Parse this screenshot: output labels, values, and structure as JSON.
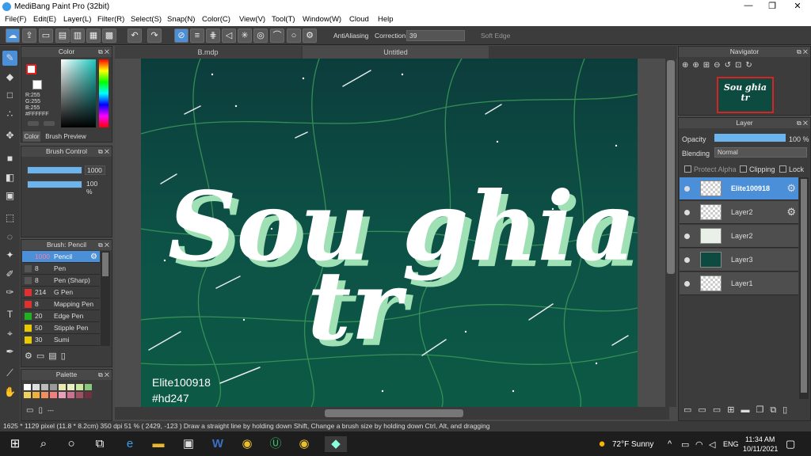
{
  "window": {
    "title": "MediBang Paint Pro (32bit)",
    "min": "—",
    "max": "❐",
    "close": "✕"
  },
  "menu": [
    "File(F)",
    "Edit(E)",
    "Layer(L)",
    "Filter(R)",
    "Select(S)",
    "Snap(N)",
    "Color(C)",
    "View(V)",
    "Tool(T)",
    "Window(W)",
    "Cloud",
    "Help"
  ],
  "toolbar": {
    "antialiasing": "AntiAliasing",
    "correction_label": "Correction",
    "correction_value": "39",
    "soft_edge": "Soft Edge"
  },
  "color_panel": {
    "title": "Color",
    "rgb": [
      "R:255",
      "G:255",
      "B:255"
    ],
    "hex": "#FFFFFF",
    "tab_color": "Color",
    "tab_preview": "Brush Preview",
    "fg": "#ffffff",
    "accent": "#e02020"
  },
  "brush_control": {
    "title": "Brush Control",
    "size": "1000",
    "opacity": "100 %"
  },
  "brush_list": {
    "title": "Brush: Pencil",
    "items": [
      {
        "size": "1000",
        "name": "Pencil",
        "color": "#4a8fd8",
        "selected": true
      },
      {
        "size": "8",
        "name": "Pen",
        "color": "#555555"
      },
      {
        "size": "8",
        "name": "Pen (Sharp)",
        "color": "#555555"
      },
      {
        "size": "214",
        "name": "G Pen",
        "color": "#e03030"
      },
      {
        "size": "8",
        "name": "Mapping Pen",
        "color": "#e03030"
      },
      {
        "size": "20",
        "name": "Edge Pen",
        "color": "#20b020"
      },
      {
        "size": "50",
        "name": "Stipple Pen",
        "color": "#e8c800"
      },
      {
        "size": "30",
        "name": "Sumi",
        "color": "#e8c800"
      }
    ]
  },
  "palette": {
    "title": "Palette",
    "footer": "---"
  },
  "tabs": [
    "B.mdp",
    "Untitled"
  ],
  "canvas": {
    "line1": "Sou ghia",
    "line2": "tr",
    "sig1": "Elite100918",
    "sig2": "#hd247"
  },
  "status": {
    "text": "1625 * 1129 pixel   (11.8 * 8.2cm)   350 dpi   51 %   ( 2429, -123 )   Draw a straight line by holding down Shift, Change a brush size by holding down Ctrl, Alt, and dragging"
  },
  "navigator": {
    "title": "Navigator"
  },
  "layers": {
    "title": "Layer",
    "opacity_label": "Opacity",
    "opacity_value": "100 %",
    "blending_label": "Blending",
    "blending_value": "Normal",
    "protect_alpha": "Protect Alpha",
    "clipping": "Clipping",
    "lock": "Lock",
    "items": [
      {
        "name": "Elite100918",
        "selected": true
      },
      {
        "name": "Layer2"
      },
      {
        "name": "Layer2"
      },
      {
        "name": "Layer3"
      },
      {
        "name": "Layer1"
      }
    ]
  },
  "taskbar": {
    "weather": "72°F  Sunny",
    "lang": "ENG",
    "time": "11:34 AM",
    "date": "10/11/2021"
  }
}
